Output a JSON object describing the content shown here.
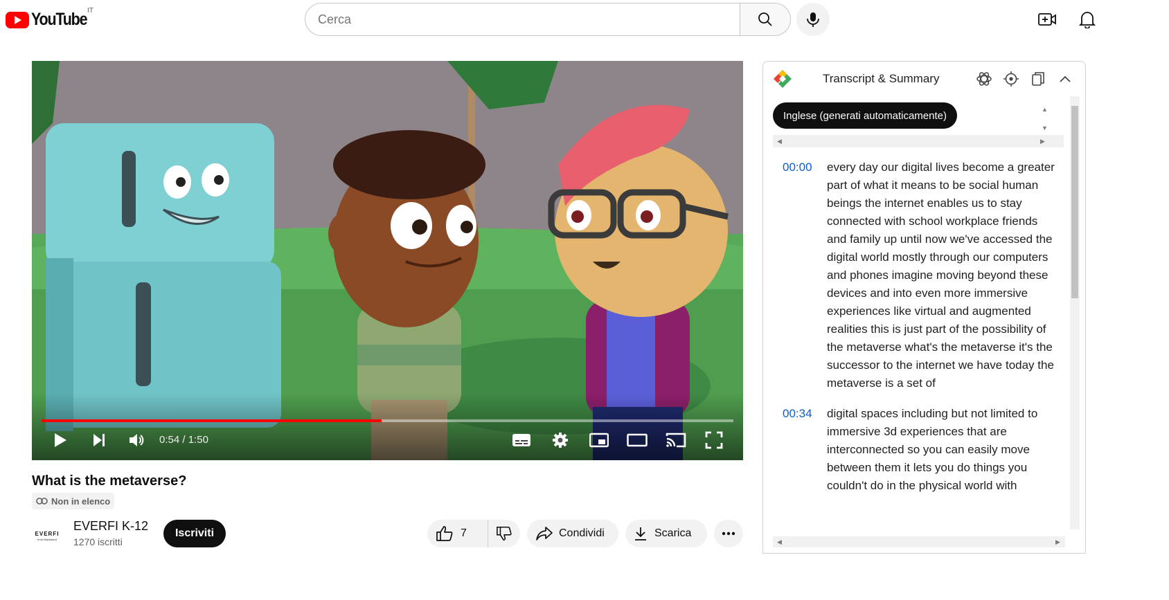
{
  "header": {
    "logo_text": "YouTube",
    "country_code": "IT",
    "search_placeholder": "Cerca",
    "icons": [
      "search-icon",
      "mic-icon",
      "create-video-icon",
      "bell-icon"
    ]
  },
  "player": {
    "time_current": "0:54",
    "time_separator": " / ",
    "time_total": "1:50",
    "progress_fraction": 0.491,
    "progress_color": "#ff0000",
    "icons": [
      "play-icon",
      "next-icon",
      "volume-icon",
      "subtitles-icon",
      "settings-icon",
      "miniplayer-icon",
      "theater-icon",
      "cast-icon",
      "fullscreen-icon"
    ]
  },
  "video": {
    "title": "What is the metaverse?",
    "visibility": "Non in elenco"
  },
  "channel": {
    "avatar_word": "EVERFI",
    "avatar_sub": "from Blackbaud",
    "name": "EVERFI K-12",
    "subscribers": "1270 iscritti",
    "subscribe_label": "Iscriviti"
  },
  "actions": {
    "likes": "7",
    "share_label": "Condividi",
    "download_label": "Scarica"
  },
  "transcript_panel": {
    "title": "Transcript & Summary",
    "language_label": "Inglese (generati automaticamente)",
    "icons": [
      "chatgpt-icon",
      "locate-icon",
      "copy-icon",
      "collapse-icon"
    ],
    "segments": [
      {
        "time": "00:00",
        "text": "every day our digital lives become a greater part of what it means to be social human beings the internet enables us to stay connected with school workplace friends and family up until now we've accessed the digital world mostly through our computers and phones imagine moving beyond these devices and into even more immersive experiences like virtual and augmented realities this is just part of the possibility of the metaverse what's the metaverse it's the successor to the internet we have today the metaverse is a set of"
      },
      {
        "time": "00:34",
        "text": "digital spaces including but not limited to immersive 3d experiences that are interconnected so you can easily move between them it lets you do things you couldn't do in the physical world with"
      }
    ]
  },
  "colors": {
    "youtube_red": "#ff0000",
    "link_blue": "#065fd4",
    "pill_gray": "#f2f2f2",
    "text_dark": "#0f0f0f"
  }
}
